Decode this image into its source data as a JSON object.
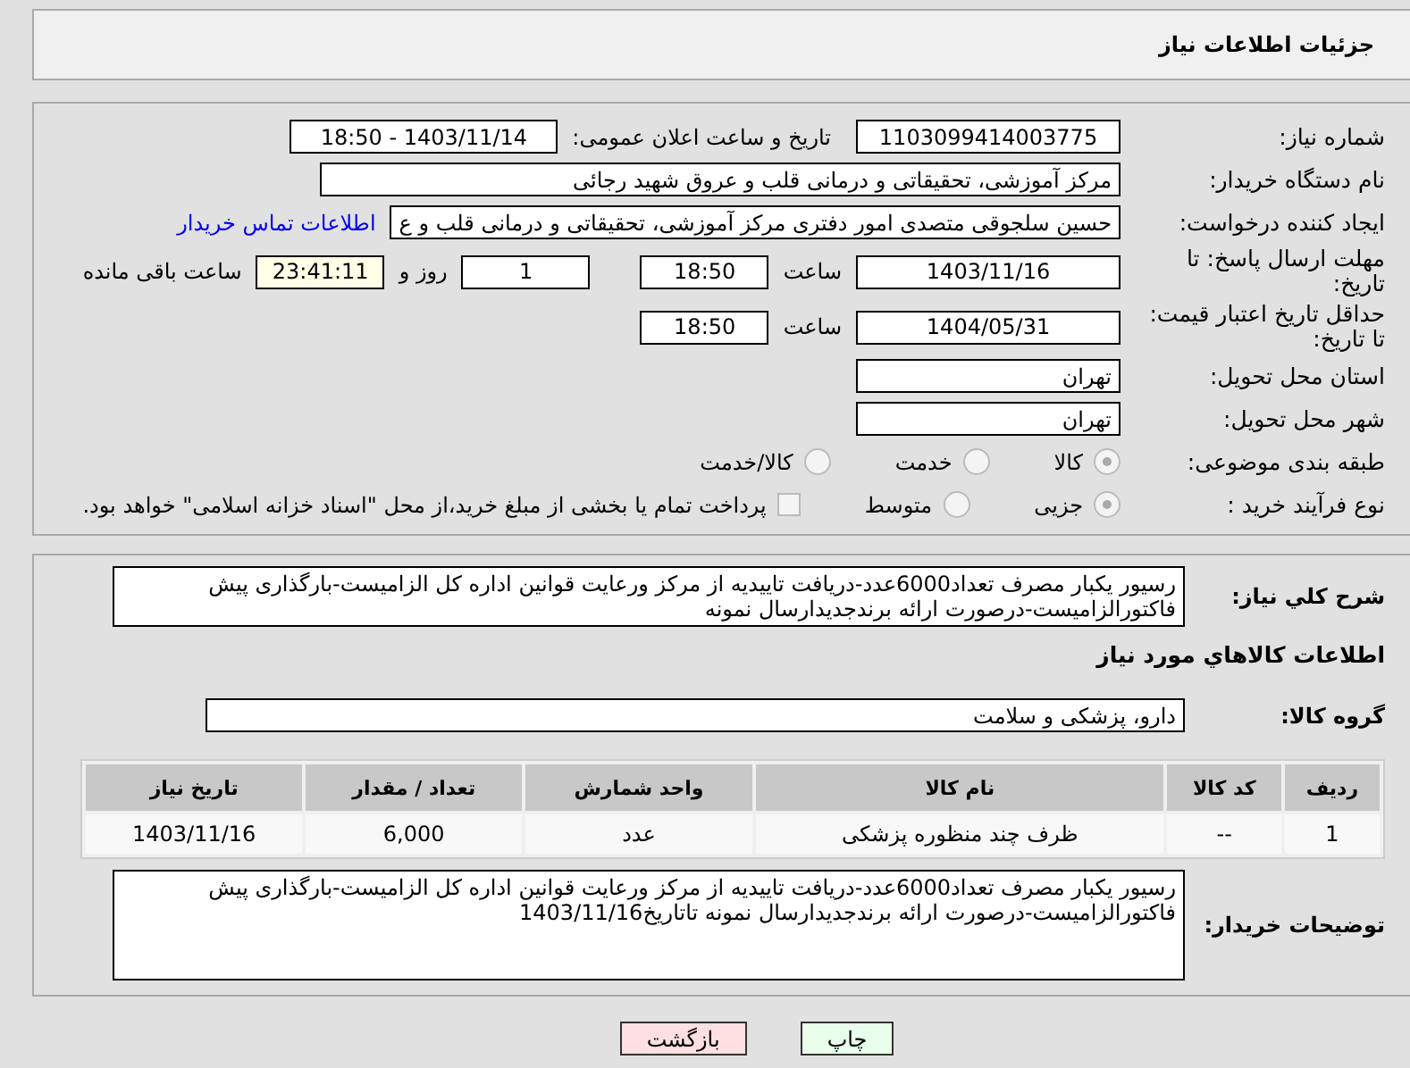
{
  "header": {
    "title": "جزئیات اطلاعات نیاز"
  },
  "rows": [
    {
      "kind": "number",
      "label": "شماره نیاز:",
      "value": "1103099414003775",
      "announce_label": "تاریخ و ساعت اعلان عمومی:",
      "announce_value": "1403/11/14 - 18:50"
    },
    {
      "kind": "text",
      "label": "نام دستگاه خریدار:",
      "value": "مرکز آموزشی، تحقیقاتی و درمانی قلب و عروق شهید رجائی"
    },
    {
      "kind": "creator",
      "label": "ایجاد کننده درخواست:",
      "value": "حسین سلجوقی متصدی امور دفتری مرکز آموزشی، تحقیقاتی و درمانی قلب و ع",
      "link": "اطلاعات تماس خریدار"
    },
    {
      "kind": "deadline",
      "label": "مهلت ارسال پاسخ: تا تاریخ:",
      "date": "1403/11/16",
      "time_label": "ساعت",
      "time": "18:50",
      "days": "1",
      "days_label": "روز و",
      "remaining": "23:41:11",
      "remaining_label": "ساعت باقی مانده"
    },
    {
      "kind": "deadline",
      "label": "حداقل تاریخ اعتبار قیمت: تا تاریخ:",
      "date": "1404/05/31",
      "time_label": "ساعت",
      "time": "18:50"
    },
    {
      "kind": "short",
      "label": "استان محل تحویل:",
      "value": "تهران"
    },
    {
      "kind": "short",
      "label": "شهر محل تحویل:",
      "value": "تهران"
    },
    {
      "kind": "radios",
      "label": "طبقه بندی موضوعی:",
      "options": [
        {
          "label": "کالا",
          "selected": true
        },
        {
          "label": "خدمت",
          "selected": false
        },
        {
          "label": "کالا/خدمت",
          "selected": false
        }
      ]
    },
    {
      "kind": "radios",
      "label": "نوع فرآیند خرید :",
      "options": [
        {
          "label": "جزیی",
          "selected": true
        },
        {
          "label": "متوسط",
          "selected": false
        }
      ],
      "checkbox": {
        "label": "پرداخت تمام یا بخشی از مبلغ خرید،از محل \"اسناد خزانه اسلامی\" خواهد بود.",
        "checked": false
      }
    }
  ],
  "summary": {
    "label": "شرح کلي نياز:",
    "value": "رسیور یکبار مصرف تعداد6000عدد-دریافت تاییدیه از مرکز ورعایت قوانین اداره کل الزامیست-بارگذاری پیش فاکتورالزامیست-درصورت ارائه برندجدیدارسال نمونه"
  },
  "goods_heading": "اطلاعات كالاهاي مورد نياز",
  "goods_group": {
    "label": "گروه کالا:",
    "value": "دارو، پزشکی و سلامت"
  },
  "table": {
    "columns": [
      "ردیف",
      "کد کالا",
      "نام کالا",
      "واحد شمارش",
      "تعداد / مقدار",
      "تاریخ نیاز"
    ],
    "rows": [
      [
        "1",
        "--",
        "ظرف چند منظوره پزشکی",
        "عدد",
        "6,000",
        "1403/11/16"
      ]
    ]
  },
  "buyer_notes": {
    "label": "توضیحات خریدار:",
    "value": "رسیور یکبار مصرف تعداد6000عدد-دریافت تاییدیه از مرکز ورعایت قوانین اداره کل الزامیست-بارگذاری پیش فاکتورالزامیست-درصورت ارائه برندجدیدارسال نمونه تاتاریخ1403/11/16"
  },
  "buttons": [
    {
      "kind": "print",
      "label": "چاپ"
    },
    {
      "kind": "back",
      "label": "بازگشت"
    }
  ]
}
